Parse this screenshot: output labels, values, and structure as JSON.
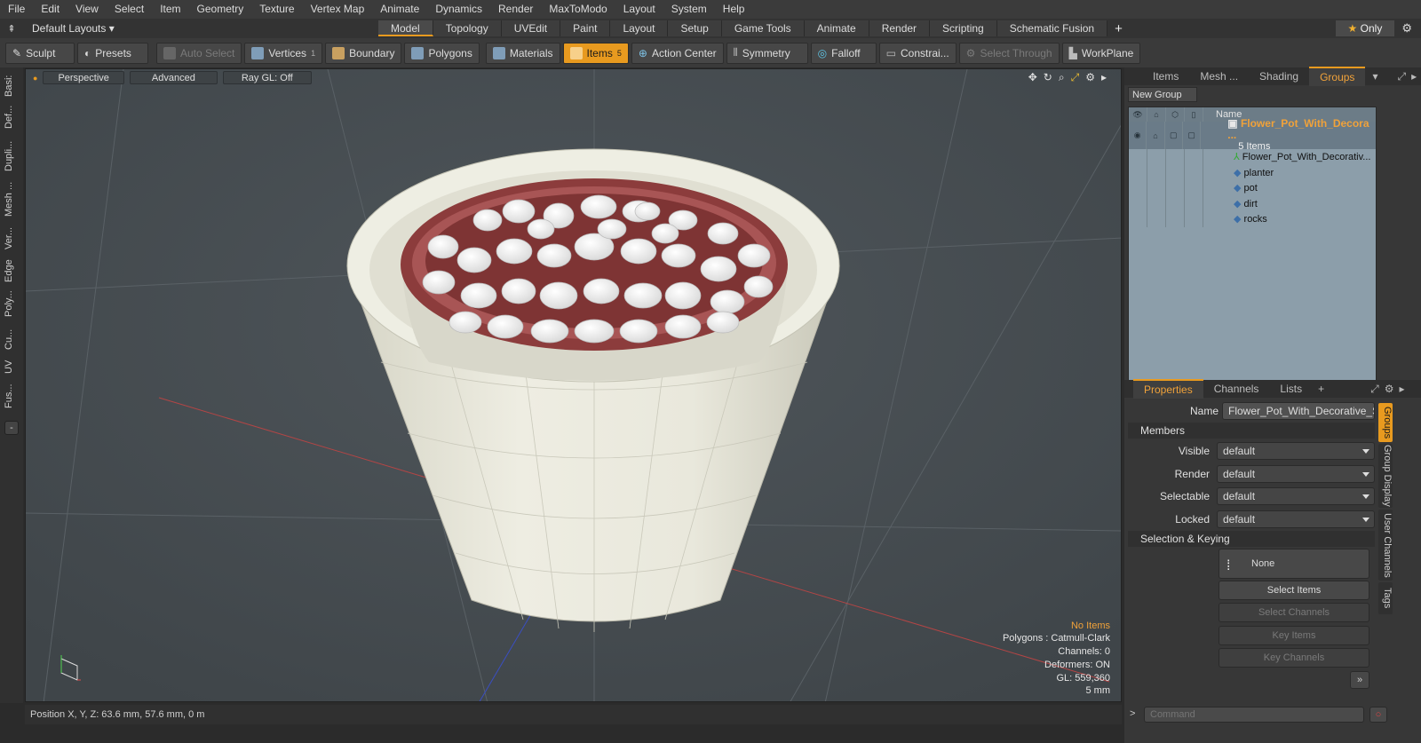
{
  "menu": [
    "File",
    "Edit",
    "View",
    "Select",
    "Item",
    "Geometry",
    "Texture",
    "Vertex Map",
    "Animate",
    "Dynamics",
    "Render",
    "MaxToModo",
    "Layout",
    "System",
    "Help"
  ],
  "layout_selector": "Default Layouts",
  "mode_tabs": [
    "Model",
    "Topology",
    "UVEdit",
    "Paint",
    "Layout",
    "Setup",
    "Game Tools",
    "Animate",
    "Render",
    "Scripting",
    "Schematic Fusion"
  ],
  "active_mode": "Model",
  "only_label": "Only",
  "toolbar": {
    "sculpt": "Sculpt",
    "presets": "Presets",
    "auto_select": "Auto Select",
    "vertices": "Vertices",
    "vertices_count": "1",
    "boundary": "Boundary",
    "polygons": "Polygons",
    "materials": "Materials",
    "items": "Items",
    "items_count": "5",
    "action_center": "Action Center",
    "symmetry": "Symmetry",
    "falloff": "Falloff",
    "constraints": "Constrai...",
    "select_through": "Select Through",
    "workplane": "WorkPlane"
  },
  "left_tabs": [
    "Basi:",
    "Def...",
    "Dupli...",
    "Mesh ...",
    "Ver...",
    "Edge",
    "Poly...",
    "Cu...",
    "UV",
    "Fus..."
  ],
  "viewport": {
    "view": "Perspective",
    "advanced": "Advanced",
    "raygl": "Ray GL: Off",
    "stats": {
      "no_items": "No Items",
      "polygons": "Polygons : Catmull-Clark",
      "channels": "Channels: 0",
      "deformers": "Deformers: ON",
      "gl": "GL: 559,360",
      "scale": "5 mm"
    }
  },
  "status": "Position X, Y, Z:  63.6 mm, 57.6 mm, 0 m",
  "right_tabs": [
    "Items",
    "Mesh ...",
    "Shading",
    "Groups"
  ],
  "active_right_tab": "Groups",
  "new_group": "New Group",
  "outliner": {
    "name_header": "Name",
    "group": {
      "name": "Flower_Pot_With_Decora ...",
      "sub": "5 Items"
    },
    "items": [
      "Flower_Pot_With_Decorativ...",
      "planter",
      "pot",
      "dirt",
      "rocks"
    ]
  },
  "props_tabs": [
    "Properties",
    "Channels",
    "Lists"
  ],
  "props": {
    "name_label": "Name",
    "name_value": "Flower_Pot_With_Decorative_Sto",
    "members": "Members",
    "visible_label": "Visible",
    "visible": "default",
    "render_label": "Render",
    "render": "default",
    "selectable_label": "Selectable",
    "selectable": "default",
    "locked_label": "Locked",
    "locked": "default",
    "selection_keying": "Selection & Keying",
    "none": "None",
    "select_items": "Select Items",
    "select_channels": "Select Channels",
    "key_items": "Key Items",
    "key_channels": "Key Channels"
  },
  "side_tabs": [
    "Groups",
    "Group Display",
    "User Channels",
    "Tags"
  ],
  "command_placeholder": "Command"
}
